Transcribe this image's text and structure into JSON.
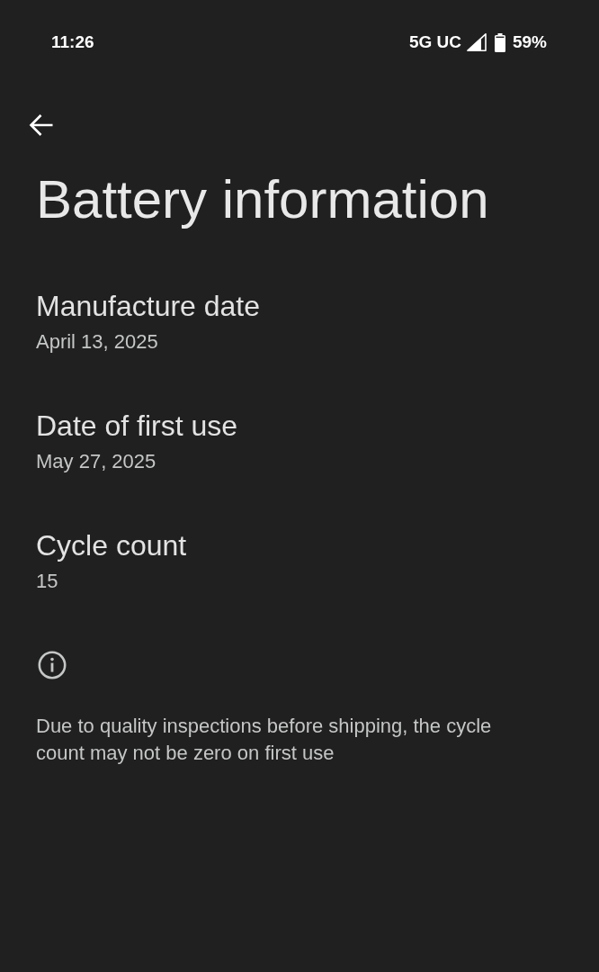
{
  "status_bar": {
    "time": "11:26",
    "network": "5G UC",
    "battery": "59%"
  },
  "title": "Battery information",
  "items": [
    {
      "label": "Manufacture date",
      "value": "April 13, 2025"
    },
    {
      "label": "Date of first use",
      "value": "May 27, 2025"
    },
    {
      "label": "Cycle count",
      "value": "15"
    }
  ],
  "footer": {
    "note": "Due to quality inspections before shipping, the cycle count may not be zero on first use"
  }
}
